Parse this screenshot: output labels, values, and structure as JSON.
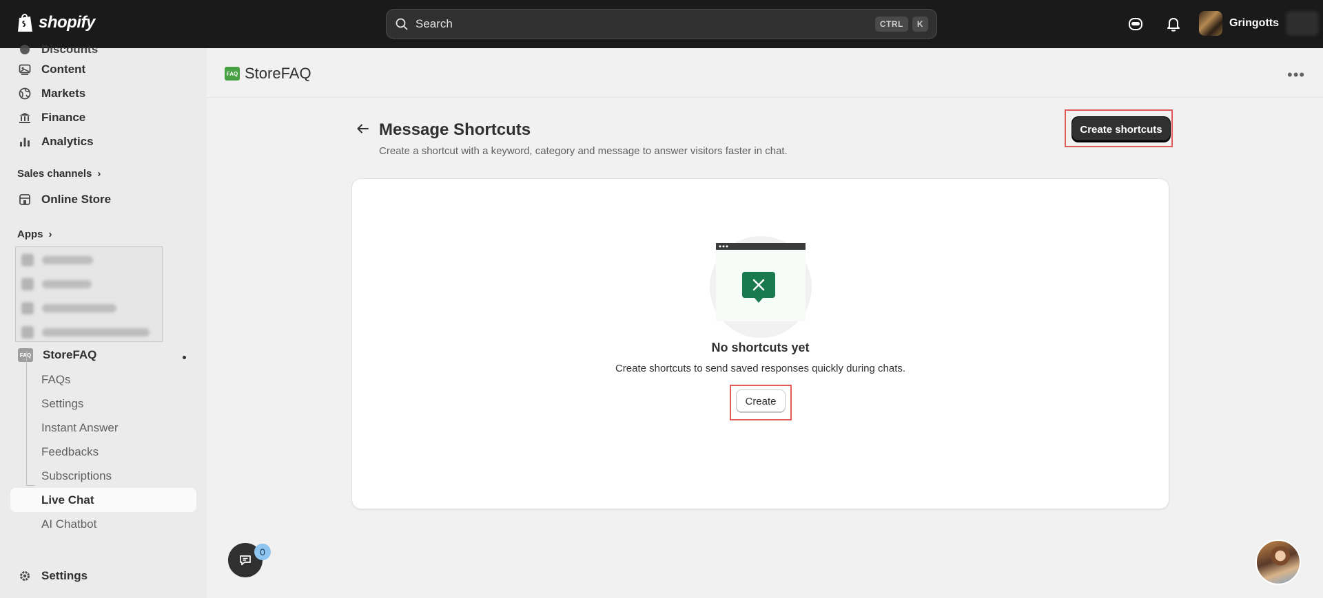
{
  "topbar": {
    "brand": "shopify",
    "search_placeholder": "Search",
    "shortcut_keys": [
      "CTRL",
      "K"
    ],
    "user_name": "Gringotts"
  },
  "sidebar": {
    "cut_item": "Discounts",
    "items": [
      {
        "label": "Content",
        "icon": "content-icon"
      },
      {
        "label": "Markets",
        "icon": "globe-icon"
      },
      {
        "label": "Finance",
        "icon": "bank-icon"
      },
      {
        "label": "Analytics",
        "icon": "bar-chart-icon"
      }
    ],
    "sales_channels_label": "Sales channels",
    "online_store_label": "Online Store",
    "apps_label": "Apps",
    "active_app": "StoreFAQ",
    "app_icon_text": "FAQ",
    "sub_items": [
      "FAQs",
      "Settings",
      "Instant Answer",
      "Feedbacks",
      "Subscriptions",
      "Live Chat",
      "AI Chatbot"
    ],
    "active_sub_item": "Live Chat",
    "settings_label": "Settings"
  },
  "app_header": {
    "title": "StoreFAQ",
    "logo_text": "FAQ"
  },
  "page": {
    "title": "Message Shortcuts",
    "subtitle": "Create a shortcut with a keyword, category and message to answer visitors faster in chat.",
    "primary_action": "Create shortcuts"
  },
  "empty_state": {
    "title": "No shortcuts yet",
    "description": "Create shortcuts to send saved responses quickly during chats.",
    "action": "Create"
  },
  "chat_widget": {
    "badge_count": "0"
  },
  "colors": {
    "topbar_bg": "#1a1a1a",
    "sidebar_bg": "#ebebeb",
    "page_bg": "#f1f1f1",
    "primary_button": "#303030",
    "highlight_border": "#e05a5a",
    "illustration_green": "#1a7a4f"
  }
}
